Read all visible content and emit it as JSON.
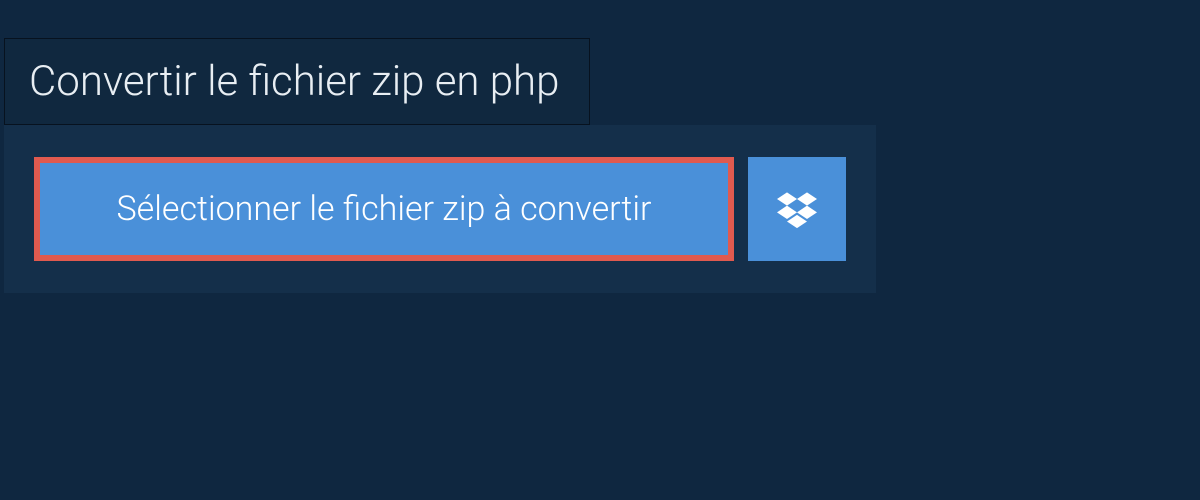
{
  "header": {
    "title": "Convertir le fichier zip en php"
  },
  "buttons": {
    "select_file_label": "Sélectionner le fichier zip à convertir"
  },
  "colors": {
    "background": "#0f2740",
    "panel": "#142f4a",
    "header_box": "#10283f",
    "button_primary": "#4a90d9",
    "button_highlight_border": "#e05a4f",
    "text_light": "#e8eef3"
  }
}
